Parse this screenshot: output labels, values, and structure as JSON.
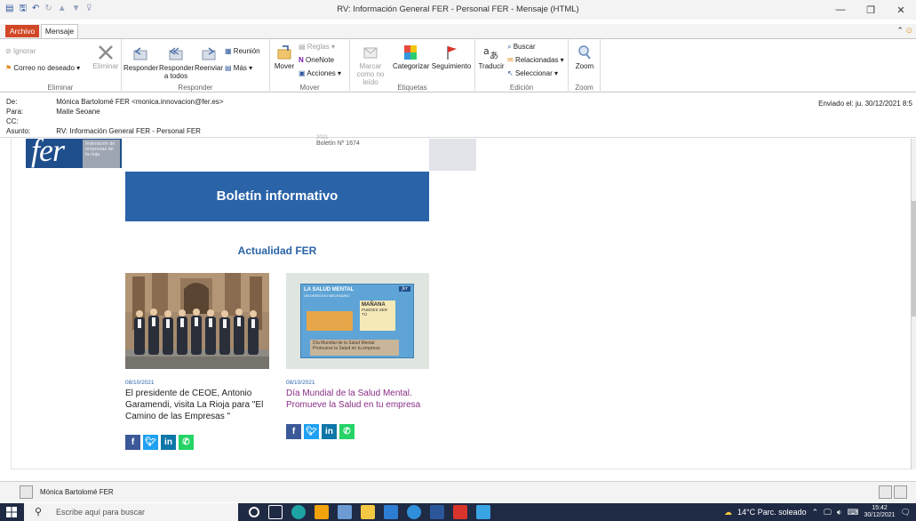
{
  "window": {
    "title": "RV: Información General FER - Personal FER - Mensaje (HTML)",
    "minimize": "—",
    "maximize": "❐",
    "close": "✕"
  },
  "tabs": [
    {
      "label": "Archivo"
    },
    {
      "label": "Mensaje"
    }
  ],
  "ribbon": {
    "eliminar": {
      "label": "Eliminar",
      "ignorar": "Ignorar",
      "correo_no_deseado": "Correo no deseado",
      "eliminar_btn": "Eliminar"
    },
    "responder": {
      "label": "Responder",
      "responder": "Responder",
      "responder_a_todos": "Responder a todos",
      "reenviar": "Reenviar",
      "reunion": "Reunión",
      "mas": "Más"
    },
    "mover": {
      "label": "Mover",
      "mover": "Mover",
      "reglas": "Reglas",
      "onenote": "OneNote",
      "acciones": "Acciones"
    },
    "etiquetas": {
      "label": "Etiquetas",
      "marcar_como_no_leido": "Marcar como no leído",
      "categorizar": "Categorizar",
      "seguimiento": "Seguimiento"
    },
    "edicion": {
      "label": "Edición",
      "traducir": "Traducir",
      "buscar": "Buscar",
      "relacionadas": "Relacionadas",
      "seleccionar": "Seleccionar"
    },
    "zoom": {
      "label": "Zoom",
      "zoom": "Zoom"
    }
  },
  "header": {
    "de_label": "De:",
    "de_value": "Mónica Bartolomé FER <monica.innovacion@fer.es>",
    "para_label": "Para:",
    "para_value": "Maite Seoane",
    "cc_label": "CC:",
    "cc_value": "",
    "asunto_label": "Asunto:",
    "asunto_value": "RV: Información General FER - Personal FER",
    "enviado_label": "Enviado el:",
    "enviado_value": "ju. 30/12/2021 8:5"
  },
  "email": {
    "logo_text": "fer",
    "logo_sub": "federación de empresas de la rioja",
    "year": "2021",
    "boletin_number": "Boletín Nº 1674",
    "banner": "Boletín informativo",
    "section_title": "Actualidad FER",
    "news": [
      {
        "date": "08/10/2021",
        "title": "El presidente de CEOE, Antonio Garamendi, visita La Rioja para \"El Camino de las Empresas \""
      },
      {
        "date": "08/10/2021",
        "title": "Día Mundial de la Salud Mental. Promueve la Salud en tu empresa"
      }
    ],
    "poster": {
      "line1": "LA SALUD MENTAL",
      "line2": "UN DERECHO NECESARIO",
      "line3": "MAÑANA",
      "line4": "PUEDES SER TÚ",
      "line5": "Día Mundial de la Salud Mental",
      "line6": "Promueve la Salud en tu empresa",
      "logo": "fer"
    },
    "social": [
      "f",
      "t",
      "in",
      "w"
    ]
  },
  "people_pane": {
    "name": "Mónica Bartolomé FER"
  },
  "taskbar": {
    "search_placeholder": "Escribe aquí para buscar",
    "weather": "14°C Parc. soleado",
    "time": "15:42",
    "date": "30/12/2021"
  },
  "colors": {
    "accent": "#2a63a8",
    "archivo_tab": "#d24726",
    "fer_logo": "#1f4e8c",
    "news_link": "#8a2d86",
    "facebook": "#3b5998",
    "twitter": "#1da1f2",
    "linkedin": "#0e76a8",
    "whatsapp": "#25d366"
  }
}
